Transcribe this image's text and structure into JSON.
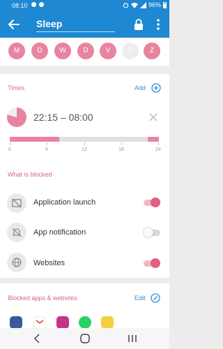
{
  "status_bar": {
    "time": "08:10",
    "battery": "96%"
  },
  "app_bar": {
    "title": "Sleep"
  },
  "days": [
    {
      "label": "M",
      "active": true
    },
    {
      "label": "D",
      "active": true
    },
    {
      "label": "W",
      "active": true
    },
    {
      "label": "D",
      "active": true
    },
    {
      "label": "V",
      "active": true
    },
    {
      "label": "Z",
      "active": false
    },
    {
      "label": "Z",
      "active": true
    }
  ],
  "times": {
    "title": "Times",
    "add_label": "Add",
    "range": "22:15 – 08:00",
    "timeline_ticks": [
      "0",
      "6",
      "12",
      "18",
      "24"
    ],
    "blocked_segments_hours": [
      [
        0,
        8
      ],
      [
        22.25,
        24
      ]
    ]
  },
  "blocked": {
    "title": "What is blocked",
    "items": [
      {
        "label": "Application launch",
        "enabled": true
      },
      {
        "label": "App notification",
        "enabled": false
      },
      {
        "label": "Websites",
        "enabled": true
      }
    ]
  },
  "apps": {
    "title": "Blocked apps & websites",
    "edit_label": "Edit",
    "icons": [
      "facebook-icon",
      "gmail-icon",
      "instagram-icon",
      "whatsapp-icon",
      "app-icon"
    ]
  },
  "colors": {
    "primary": "#1e88d2",
    "accent_pink": "#e8849f",
    "link_blue": "#2d8fd3"
  }
}
